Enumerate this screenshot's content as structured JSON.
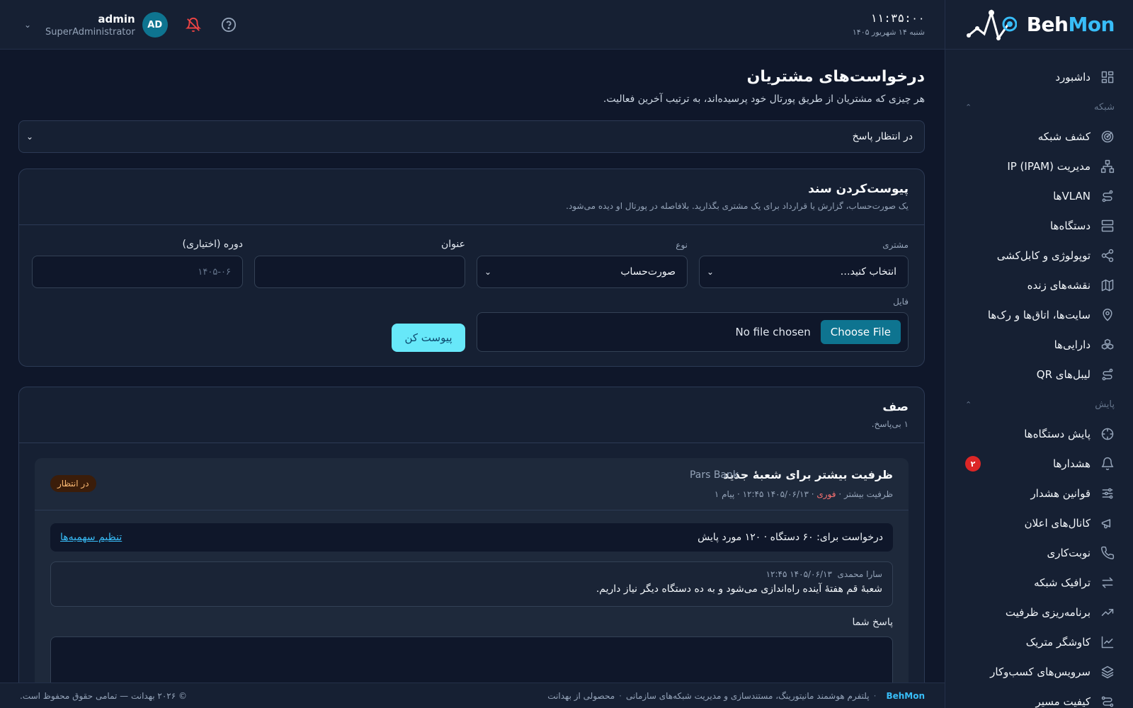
{
  "brand": {
    "part1": "Beh",
    "part2": "Mon"
  },
  "topbar": {
    "time": "۱۱:۳۵:۰۰",
    "date": "شنبه ۱۴ شهریور ۱۴۰۵",
    "user_name": "admin",
    "user_role": "SuperAdministrator",
    "avatar_initials": "AD"
  },
  "sidebar": {
    "items": [
      {
        "label": "داشبورد",
        "icon": "dashboard-icon"
      },
      {
        "section": "شبکه"
      },
      {
        "label": "کشف شبکه",
        "icon": "radar-icon"
      },
      {
        "label": "مدیریت IP (IPAM)",
        "icon": "network-tree-icon"
      },
      {
        "label": "VLANها",
        "icon": "route-icon"
      },
      {
        "label": "دستگاه‌ها",
        "icon": "server-icon"
      },
      {
        "label": "توپولوژی و کابل‌کشی",
        "icon": "share-icon"
      },
      {
        "label": "نقشه‌های زنده",
        "icon": "map-icon"
      },
      {
        "label": "سایت‌ها، اتاق‌ها و رک‌ها",
        "icon": "location-pin-icon"
      },
      {
        "label": "دارایی‌ها",
        "icon": "boxes-icon"
      },
      {
        "label": "لیبل‌های QR",
        "icon": "route-icon"
      },
      {
        "section": "پایش"
      },
      {
        "label": "پایش دستگاه‌ها",
        "icon": "crosshair-icon"
      },
      {
        "label": "هشدارها",
        "icon": "bell-icon",
        "badge": "۲"
      },
      {
        "label": "قوانین هشدار",
        "icon": "sliders-icon"
      },
      {
        "label": "کانال‌های اعلان",
        "icon": "megaphone-icon"
      },
      {
        "label": "نوبت‌کاری",
        "icon": "phone-icon"
      },
      {
        "label": "ترافیک شبکه",
        "icon": "arrows-icon"
      },
      {
        "label": "برنامه‌ریزی ظرفیت",
        "icon": "trend-icon"
      },
      {
        "label": "کاوشگر متریک",
        "icon": "chart-line-icon"
      },
      {
        "label": "سرویس‌های کسب‌وکار",
        "icon": "layers-icon"
      },
      {
        "label": "کیفیت مسیر",
        "icon": "path-icon"
      }
    ]
  },
  "page": {
    "title": "درخواست‌های مشتریان",
    "subtitle": "هر چیزی که مشتریان از طریق پورتال خود پرسیده‌اند، به ترتیب آخرین فعالیت.",
    "filter_value": "در انتظار پاسخ"
  },
  "attach": {
    "title": "پیوست‌کردن سند",
    "desc": "یک صورت‌حساب، گزارش یا قرارداد برای یک مشتری بگذارید. بلافاصله در پورتال او دیده می‌شود.",
    "customer_label": "مشتری",
    "customer_value": "انتخاب کنید…",
    "type_label": "نوع",
    "type_value": "صورت‌حساب",
    "title_label": "عنوان",
    "title_value": "",
    "period_label": "دوره (اختیاری)",
    "period_placeholder": "۱۴۰۵-۰۶",
    "file_label": "فایل",
    "file_button": "Choose File",
    "file_status": "No file chosen",
    "submit": "پیوست کن"
  },
  "queue": {
    "title": "صف",
    "desc": "۱ بی‌پاسخ.",
    "request": {
      "title": "ظرفیت بیشتر برای شعبهٔ جدید",
      "company": "Pars Bank",
      "meta_category": "ظرفیت بیشتر",
      "meta_priority": "فوری",
      "meta_rest": "۱۴۰۵/۰۶/۱۳ ۱۲:۴۵ · پیام ۱",
      "status": "در انتظار",
      "quota_text": "درخواست برای: ۶۰ دستگاه · ۱۲۰ مورد پایش",
      "quota_link": "تنظیم سهمیه‌ها",
      "message_author": "سارا محمدی",
      "message_time": "۱۴۰۵/۰۶/۱۳ ۱۲:۴۵",
      "message_body": "شعبهٔ قم هفتهٔ آینده راه‌اندازی می‌شود و به ده دستگاه دیگر نیاز داریم.",
      "reply_label": "پاسخ شما"
    }
  },
  "footer": {
    "brand": "BehMon",
    "tagline": "پلتفرم هوشمند مانیتورینگ، مستندسازی و مدیریت شبکه‌های سازمانی",
    "product": "محصولی از بهدانت",
    "copyright": "© ۲۰۲۶ بهدانت — تمامی حقوق محفوظ است."
  },
  "colors": {
    "accent": "#38bdf8",
    "button": "#67e8f9",
    "danger": "#dc2626",
    "bg": "#0f172a",
    "panel": "#162033"
  }
}
